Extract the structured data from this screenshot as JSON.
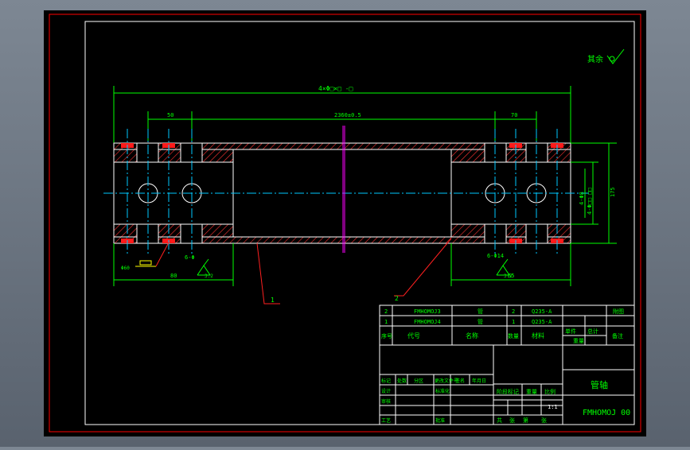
{
  "colors": {
    "background": "#000000",
    "frame": "#ff0000",
    "outline": "#ffffff",
    "hatch": "#ff3333",
    "centerline": "#00c8ff",
    "dimension": "#00ff00",
    "text": "#00ff00",
    "leader": "#ff2020",
    "symmetry": "#ff00ff"
  },
  "drawing": {
    "surface_note": "其余",
    "overall_dim": "4×Φ□×□ -□",
    "dim_left_top": "50",
    "dim_center": "2360±0.5",
    "dim_right_top": "70",
    "dim_right_v1": "4-Φ8",
    "dim_right_v2": "4-Φ□□ □□",
    "dim_right_v3": "175",
    "dim_left_bottom": "80",
    "dim_right_bottom": "65",
    "tol_left": "6-Φ",
    "tol_right": "6-Φ14",
    "rough_left": "3.2",
    "rough_right": "3.2",
    "marker_left": "Φ60",
    "leader_1": "1",
    "leader_2": "2"
  },
  "title_block": {
    "parts": [
      {
        "no": "2",
        "code": "FMHOMOJ3",
        "name": "管",
        "qty": "2",
        "material": "Q235-A",
        "note": "附图"
      },
      {
        "no": "1",
        "code": "FMHOMOJ4",
        "name": "管",
        "qty": "1",
        "material": "Q235-A",
        "note": ""
      }
    ],
    "header": {
      "no": "序号",
      "code": "代号",
      "name": "名称",
      "qty": "数量",
      "material": "材料",
      "unit_weight": "单件",
      "total_weight": "总计",
      "weight": "重量",
      "note": "备注"
    },
    "revision": {
      "mark": "标记",
      "count": "处数",
      "zone": "分区",
      "doc": "更改文件号",
      "sign": "签名",
      "date": "年月日"
    },
    "roles": {
      "design": "设计",
      "standard": "标准化",
      "review": "审核",
      "process": "工艺",
      "approve": "批准"
    },
    "stage": {
      "stage_mark": "阶段标记",
      "weight": "重量",
      "scale": "比例",
      "scale_value": "1:1",
      "sheets": "共",
      "sheet": "张",
      "page": "第",
      "page2": "张"
    },
    "title": "管轴",
    "drawing_no": "FMHOMOJ 00"
  }
}
